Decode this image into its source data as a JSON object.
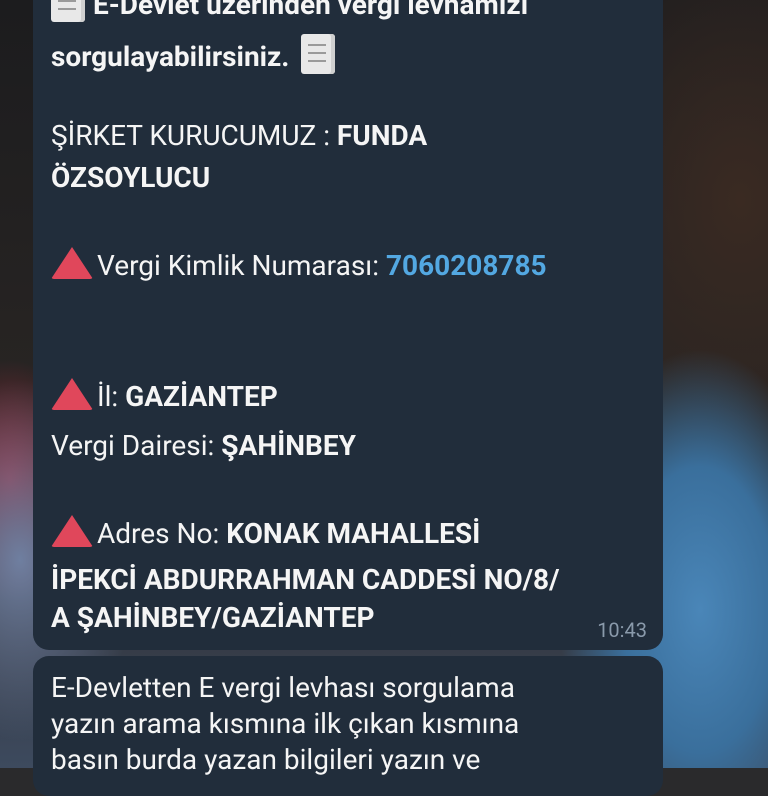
{
  "message1": {
    "line_top_partial": "E-Devlet üzerinden vergi levhamızı",
    "line_query": "sorgulayabilirsiniz.",
    "founder_label": "ŞİRKET KURUCUMUZ : ",
    "founder_name_1": "FUNDA",
    "founder_name_2": "ÖZSOYLUCU",
    "tax_id_label": "Vergi Kimlik Numarası: ",
    "tax_id_value": "7060208785",
    "province_label": "İl: ",
    "province_value": "GAZİANTEP",
    "tax_office_label": "Vergi Dairesi: ",
    "tax_office_value": "ŞAHİNBEY",
    "address_label": "Adres No: ",
    "address_line_1": "KONAK MAHALLESİ",
    "address_line_2": "İPEKCİ ABDURRAHMAN CADDESİ NO/8/",
    "address_line_3": "A ŞAHİNBEY/GAZİANTEP",
    "time": "10:43"
  },
  "message2": {
    "line_1": "E-Devletten E vergi levhası sorgulama",
    "line_2": "yazın arama kısmına ilk çıkan kısmına",
    "line_3": "basın burda yazan bilgileri yazın ve"
  }
}
